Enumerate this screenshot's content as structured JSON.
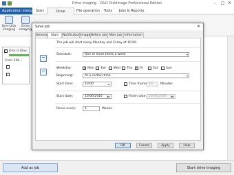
{
  "app": {
    "title": "Drive imaging - O&O DiskImage Professional Edition",
    "menu_label": "Application menu",
    "tabs": [
      "Start",
      "Drive operation",
      "File operation",
      "Tools",
      "Jobs & Reports"
    ],
    "active_tab": "Drive operation"
  },
  "ribbon": {
    "buttons": [
      {
        "label": "One-click imaging",
        "icon": "camera-icon"
      },
      {
        "label": "Drive imaging",
        "icon": "drive-icon"
      }
    ]
  },
  "drives": {
    "disk_label": "Disk 0 (Basi",
    "from_label": "From 298..."
  },
  "bottom": {
    "add_as_job": "Add as job",
    "start_imaging": "Start drive imaging"
  },
  "dialog": {
    "title": "Save job",
    "tabs": [
      "General",
      "Start time",
      "Notification",
      "Image",
      "Before job",
      "After job",
      "Information"
    ],
    "active_tab": "Start time",
    "summary": "The job will start every Monday and Friday at 10:00.",
    "schedule_label": "Schedule:",
    "schedule_value": "One or more times a week",
    "weekday_label": "Weekday:",
    "weekdays": [
      {
        "label": "Mon",
        "checked": true
      },
      {
        "label": "Tue",
        "checked": false
      },
      {
        "label": "Wed",
        "checked": false
      },
      {
        "label": "Thu",
        "checked": false
      },
      {
        "label": "Fri",
        "checked": true
      },
      {
        "label": "Sat",
        "checked": false
      },
      {
        "label": "Sun",
        "checked": false
      }
    ],
    "beginning_label": "Beginning:",
    "beginning_value": "At a certain time",
    "start_time_label": "Start time:",
    "start_time_value": "10:00",
    "time_frame_label": "Time frame:",
    "time_frame_value": "10",
    "time_frame_unit": "Minutes",
    "start_date_label": "Start date:",
    "start_date_value": "13/06/2016",
    "finish_date_label": "Finish date:",
    "finish_date_value": "20/06/2016",
    "recur_label": "Recur every:",
    "recur_value": "1",
    "recur_unit": "Weeks",
    "buttons": {
      "ok": "OK",
      "cancel": "Cancel",
      "apply": "Apply",
      "help": "Help"
    }
  },
  "colors": {
    "accent": "#1e5fae",
    "progress": "#57b84b"
  }
}
